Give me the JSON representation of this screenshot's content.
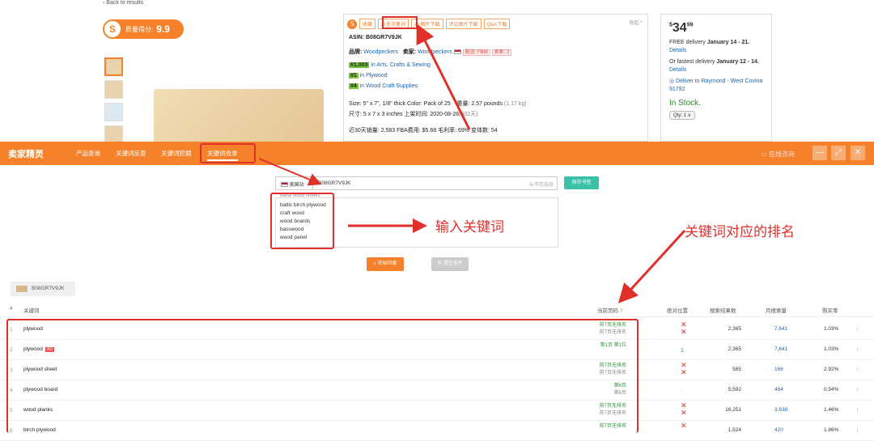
{
  "product_page": {
    "back_link": "‹ Back to results",
    "score_label": "质量得分:",
    "score_value": "9.9",
    "toolbar": [
      "收藏",
      "反查流量词",
      "A+图片下载",
      "评论图片下载",
      "Q&A下载"
    ],
    "collapse": "收起 ^",
    "asin_line": "ASIN: B08GR7V9JK",
    "brand_label": "品牌:",
    "brand_value": "Woodpeckers",
    "seller_label": "卖家:",
    "seller_value": "Woodpeckers",
    "fulfillment": "配送: FBM",
    "sellers_count": "卖家: 2",
    "rank1_badge": "#1,003",
    "rank1_text": "in Arts, Crafts & Sewing",
    "rank2_badge": "#1",
    "rank2_text": "in Plywood",
    "rank3_badge": "#4",
    "rank3_text": "in Wood Craft Supplies",
    "size_line": "Size: 5\" x 7\", 1/8\" thick    Color: Pack of 25",
    "weight_line": "重量: 2.57 pounds",
    "weight_kg": "(1.17 kg)",
    "dims_line": "尺寸: 5 x 7 x 3 inches    上架时间: 2020-08-26",
    "days": "(502天)",
    "sales_line": "近30天销量: 2,583    FBA费用: $5.68    毛利率: 69%    变体数: 54"
  },
  "buy_box": {
    "price_sym": "$",
    "price_int": "34",
    "price_cents": "99",
    "delivery_pre": "FREE delivery ",
    "delivery_date": "January 14 - 21.",
    "details": "Details",
    "fast_pre": "Or fastest delivery ",
    "fast_date": "January 12 - 14.",
    "deliver_to": "Deliver to Raymond - West Covina 91792",
    "stock": "In Stock.",
    "qty": "Qty: 1 ∨"
  },
  "header": {
    "brand": "卖家精灵",
    "nav": [
      "产品查询",
      "关键词反查",
      "关键词挖掘",
      "关键词收录"
    ],
    "online": "在线咨询"
  },
  "search": {
    "site": "美国站",
    "asin": "B08GR7V9JK",
    "hint": "从书签选择",
    "save": "保存书签"
  },
  "keywords": [
    "baltic birch plywood",
    "craft wood",
    "wood boards",
    "basswood",
    "wood panel"
  ],
  "keyword_top_partial": "balsa wood sheets",
  "buttons": {
    "start": "开始检索",
    "clear": "清空条件"
  },
  "annotations": {
    "input_kw": "输入关键词",
    "kw_rank": "关键词对应的排名"
  },
  "tab": "B08GR7V9JK",
  "table": {
    "headers": [
      "#",
      "关键词",
      "当前页码",
      "绝对位置",
      "搜索结果数",
      "月搜索量",
      "购买率"
    ],
    "rows": [
      {
        "idx": "1",
        "kw": "plywood",
        "ad": "",
        "rank": "前7页无排名",
        "rank2": "前7页无排名",
        "abs": "✕\n✕",
        "results": "2,365",
        "vol": "7,641",
        "rate": "1.03%"
      },
      {
        "idx": "2",
        "kw": "plywood",
        "ad": "AD",
        "rank": "第1页 第1位",
        "rank2": "",
        "abs": "1",
        "results": "2,365",
        "vol": "7,641",
        "rate": "1.03%"
      },
      {
        "idx": "3",
        "kw": "plywood sheet",
        "ad": "",
        "rank": "前7页无排名",
        "rank2": "前7页无排名",
        "abs": "✕\n✕",
        "results": "585",
        "vol": "166",
        "rate": "2.92%"
      },
      {
        "idx": "4",
        "kw": "plywood board",
        "ad": "",
        "rank": "第6页",
        "rank2": "第6页",
        "abs": "-",
        "results": "5,592",
        "vol": "484",
        "rate": "0.54%"
      },
      {
        "idx": "5",
        "kw": "wood planks",
        "ad": "",
        "rank": "前7页无排名",
        "rank2": "前7页无排名",
        "abs": "✕\n✕",
        "results": "16,251",
        "vol": "3,638",
        "rate": "1.46%"
      },
      {
        "idx": "6",
        "kw": "birch plywood",
        "ad": "",
        "rank": "前7页无排名",
        "rank2": "",
        "abs": "✕",
        "results": "1,524",
        "vol": "420",
        "rate": "1.86%"
      }
    ]
  }
}
